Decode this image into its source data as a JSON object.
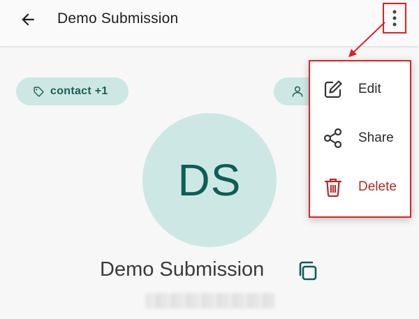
{
  "app_bar": {
    "title": "Demo Submission",
    "back_icon": "arrow-left-icon",
    "more_icon": "more-vertical-icon"
  },
  "chips": {
    "tags_label": "contact +1",
    "tags_icon": "tag-icon",
    "owner_icon": "person-icon"
  },
  "contact": {
    "initials": "DS",
    "name": "Demo Submission",
    "copy_icon": "copy-icon"
  },
  "menu": {
    "items": [
      {
        "label": "Edit",
        "icon": "edit-icon"
      },
      {
        "label": "Share",
        "icon": "share-icon"
      },
      {
        "label": "Delete",
        "icon": "trash-icon"
      }
    ]
  },
  "colors": {
    "accent_soft": "#cde8e4",
    "accent_dark": "#0d5e54",
    "danger": "#b02a2a",
    "highlight": "#e02020"
  }
}
